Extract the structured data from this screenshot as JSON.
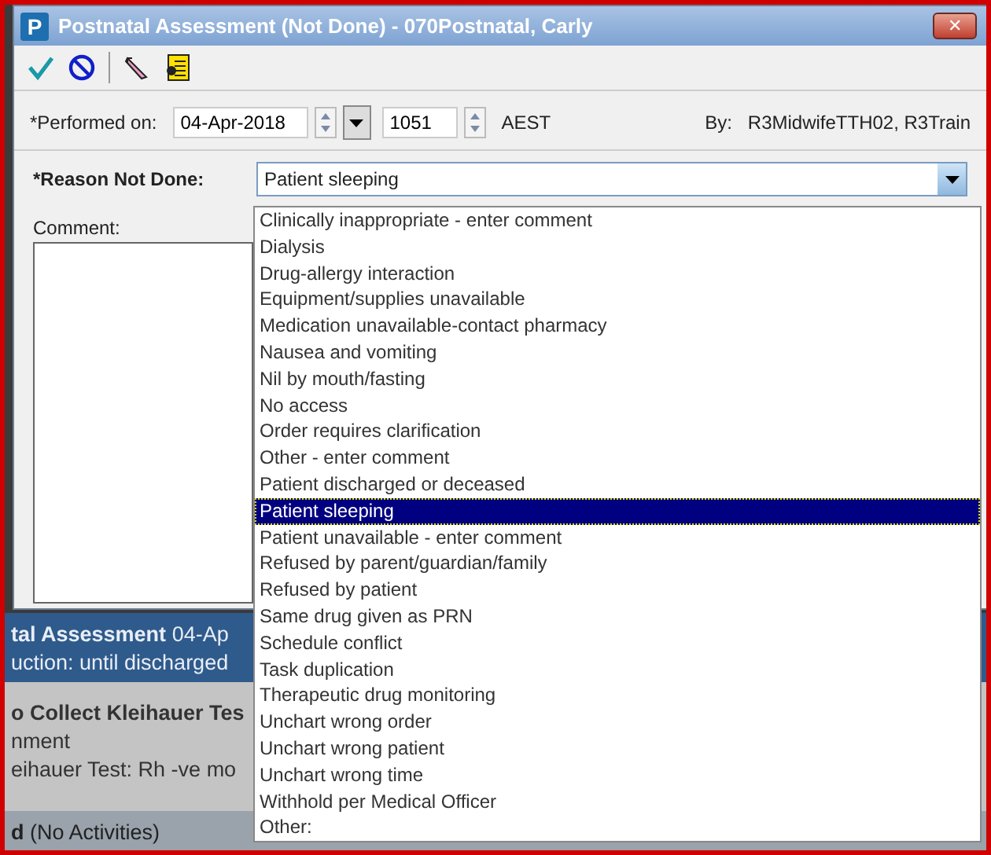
{
  "window": {
    "title": "Postnatal Assessment (Not Done) - 070Postnatal, Carly",
    "app_letter": "P",
    "close": "✕"
  },
  "toolbar": [
    {
      "kind": "check"
    },
    {
      "kind": "cancel"
    },
    {
      "kind": "pencil"
    },
    {
      "kind": "notes"
    }
  ],
  "performed": {
    "label": "*Performed on:",
    "date": "04-Apr-2018",
    "time": "1051",
    "timezone": "AEST",
    "by_label": "By:",
    "by": "R3MidwifeTTH02, R3Train"
  },
  "reason": {
    "label": "*Reason Not Done:",
    "value": "Patient sleeping",
    "expanded": true
  },
  "comment": {
    "label": "Comment:"
  },
  "options": [
    {
      "label": "Clinically inappropriate - enter comment",
      "selected": false
    },
    {
      "label": "Dialysis",
      "selected": false
    },
    {
      "label": "Drug-allergy interaction",
      "selected": false
    },
    {
      "label": "Equipment/supplies unavailable",
      "selected": false
    },
    {
      "label": "Medication unavailable-contact pharmacy",
      "selected": false
    },
    {
      "label": "Nausea and vomiting",
      "selected": false
    },
    {
      "label": "Nil by mouth/fasting",
      "selected": false
    },
    {
      "label": "No access",
      "selected": false
    },
    {
      "label": "Order requires clarification",
      "selected": false
    },
    {
      "label": "Other - enter comment",
      "selected": false
    },
    {
      "label": "Patient discharged or deceased",
      "selected": false
    },
    {
      "label": "Patient sleeping",
      "selected": true
    },
    {
      "label": "Patient unavailable - enter comment",
      "selected": false
    },
    {
      "label": "Refused by parent/guardian/family",
      "selected": false
    },
    {
      "label": "Refused by patient",
      "selected": false
    },
    {
      "label": "Same drug given as PRN",
      "selected": false
    },
    {
      "label": "Schedule conflict",
      "selected": false
    },
    {
      "label": "Task duplication",
      "selected": false
    },
    {
      "label": "Therapeutic drug monitoring",
      "selected": false
    },
    {
      "label": "Unchart wrong order",
      "selected": false
    },
    {
      "label": "Unchart wrong patient",
      "selected": false
    },
    {
      "label": "Unchart wrong time",
      "selected": false
    },
    {
      "label": "Withhold per Medical Officer",
      "selected": false
    },
    {
      "label": "Other:",
      "selected": false
    }
  ],
  "background": [
    {
      "kind": "header",
      "lines": [
        "**tal Assessment** 04-Ap",
        "uction: until discharged"
      ]
    },
    {
      "kind": "task",
      "lines": [
        "**o Collect Kleihauer Tes**",
        "nment",
        "eihauer Test: Rh -ve mo"
      ]
    },
    {
      "kind": "footer",
      "lines": [
        "**d** (No Activities)"
      ]
    }
  ]
}
